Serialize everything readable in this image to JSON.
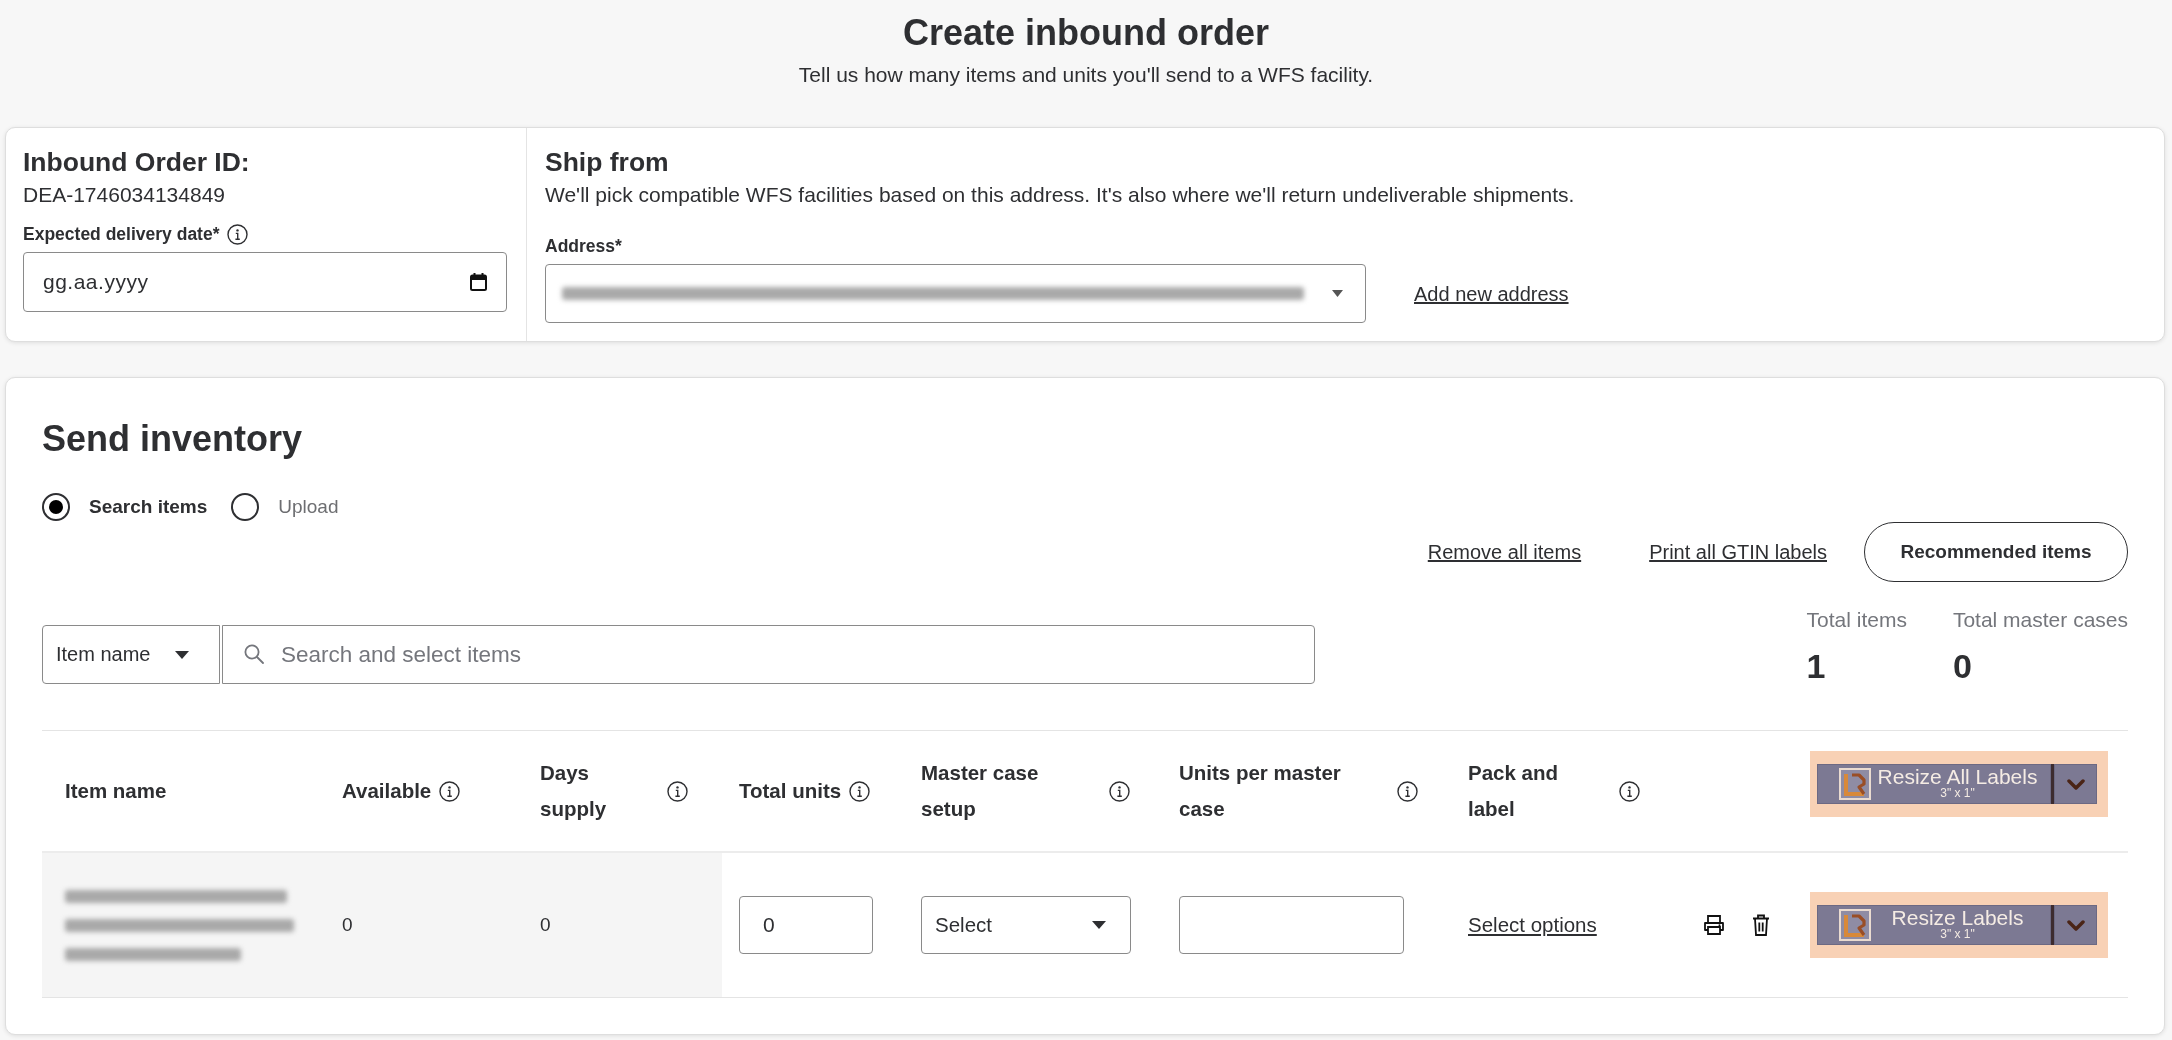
{
  "page": {
    "title": "Create inbound order",
    "subtitle": "Tell us how many items and units you'll send to a WFS facility."
  },
  "order": {
    "id_label": "Inbound Order ID:",
    "id": "DEA-1746034134849",
    "delivery_date": {
      "label": "Expected delivery date*",
      "placeholder": "gg.aa.yyyy"
    }
  },
  "ship_from": {
    "title": "Ship from",
    "description": "We'll pick compatible WFS facilities based on this address. It's also where we'll return undeliverable shipments.",
    "address": {
      "label": "Address*"
    },
    "add_link": "Add new address"
  },
  "send_inventory": {
    "title": "Send inventory",
    "modes": [
      {
        "label": "Search items",
        "selected": true
      },
      {
        "label": "Upload",
        "selected": false
      }
    ],
    "links": [
      "Remove all items",
      "Print all GTIN labels"
    ],
    "recommended_button": "Recommended items",
    "totals": [
      {
        "label": "Total items",
        "value": "1"
      },
      {
        "label": "Total master cases",
        "value": "0"
      }
    ],
    "search": {
      "filter": "Item name",
      "placeholder": "Search and select items"
    },
    "table": {
      "columns": [
        {
          "label": "Item name",
          "info": false
        },
        {
          "label": "Available",
          "info": true
        },
        {
          "label": "Days supply",
          "info": true
        },
        {
          "label": "Total units",
          "info": true
        },
        {
          "label": "Master case setup",
          "info": true
        },
        {
          "label": "Units per master case",
          "info": true
        },
        {
          "label": "Pack and label",
          "info": true
        }
      ],
      "resize_all": {
        "label": "Resize All Labels",
        "size": "3\" x 1\""
      },
      "rows": [
        {
          "available": "0",
          "days_supply": "0",
          "total_units": "0",
          "master_case_setup": "Select",
          "pack_and_label": "Select options",
          "resize": {
            "label": "Resize Labels",
            "size": "3\" x 1\""
          }
        }
      ]
    }
  }
}
